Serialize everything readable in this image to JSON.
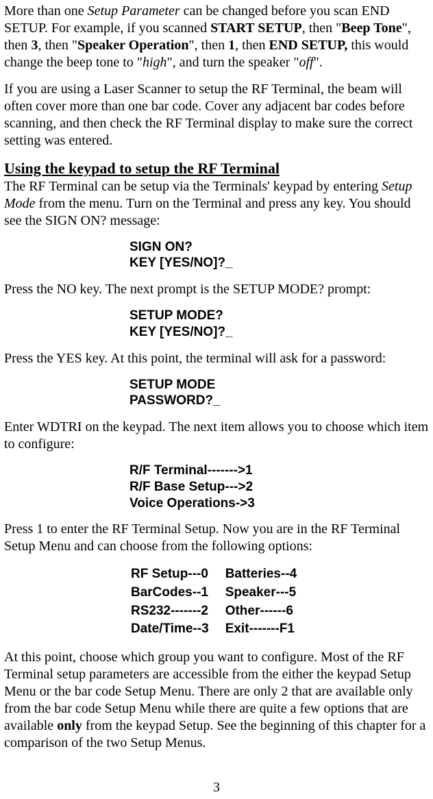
{
  "para1": {
    "t1": "More than one ",
    "i1": "Setup Parameter",
    "t2": " can be changed before you scan END SETUP.  For example, if you scanned ",
    "b1": "START SETUP",
    "t3": ", then \"",
    "b2": "Beep Tone",
    "t4": "\", then ",
    "b3": "3",
    "t5": ", then  \"",
    "b4": "Speaker Operation",
    "t6": "\", then ",
    "b5": "1",
    "t7": ", then ",
    "b6": "END SETUP,",
    "t8": " this would change the beep tone to \"",
    "i2": "high",
    "t9": "\", and turn the speaker \"",
    "i3": "off",
    "t10": "\"."
  },
  "para2": "If you are using a Laser Scanner to setup the RF Terminal, the beam will often cover more than one bar code. Cover any adjacent bar codes before scanning, and then check the RF Terminal display to make sure the correct setting was entered.",
  "heading1": "Using the keypad to setup the RF Terminal",
  "para3": {
    "t1": "The RF Terminal can be setup via the Terminals' keypad by entering ",
    "i1": "Setup Mode",
    "t2": " from the menu. Turn on the Terminal and press any key. You should see the SIGN ON? message:"
  },
  "display1": "SIGN ON?\nKEY [YES/NO]?_",
  "para4": "Press the NO key.  The next prompt is the SETUP MODE? prompt:",
  "display2": "SETUP MODE?\nKEY [YES/NO]?_",
  "para5": "Press the YES key.  At this point, the terminal will ask for a password:",
  "display3": "SETUP MODE\nPASSWORD?_",
  "para6": "Enter WDTRI on the keypad.  The next item allows you to choose which item to configure:",
  "display4": "R/F Terminal------->1\nR/F Base Setup--->2\nVoice Operations->3",
  "para7": "Press 1 to enter the RF Terminal Setup. Now you are in the RF Terminal Setup Menu and can choose from the following options:",
  "menu": {
    "rows": [
      [
        "RF Setup---0",
        "Batteries--4"
      ],
      [
        "BarCodes--1",
        "Speaker---5"
      ],
      [
        "RS232-------2",
        "Other------6"
      ],
      [
        "Date/Time--3",
        "Exit-------F1"
      ]
    ]
  },
  "para8": {
    "t1": "At this point, choose which group you want to configure. Most of the RF Terminal setup parameters are accessible from the either the keypad Setup Menu or the bar code Setup Menu. There are only 2 that are available only from the bar code Setup Menu while there are quite a few options that are available ",
    "b1": "only",
    "t2": " from the keypad Setup.  See the beginning of this chapter for a comparison of the two Setup Menus."
  },
  "pageNumber": "3"
}
